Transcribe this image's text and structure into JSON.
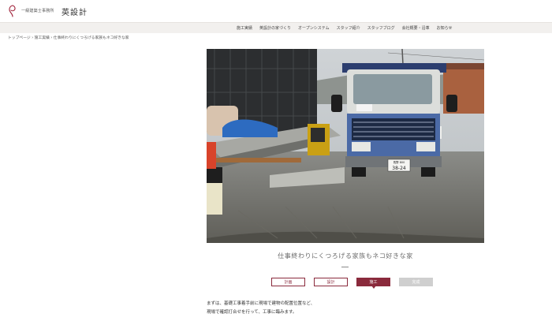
{
  "brand": {
    "sub": "一級建築士事務所",
    "name": "英設計"
  },
  "nav": {
    "items": [
      "施工実績",
      "英設計の家づくり",
      "オープンシステム",
      "スタッフ紹介",
      "スタッフブログ",
      "会社概要・沿革",
      "お知らせ"
    ]
  },
  "breadcrumb": "トップページ › 施工実績 › 仕事終わりにくつろげる家族もネコ好きな家",
  "photo": {
    "plate_top": "長野 800",
    "plate_num": "38-24"
  },
  "post": {
    "title": "仕事終わりにくつろげる家族もネコ好きな家",
    "steps": [
      "計画",
      "設計",
      "施工",
      "完成"
    ],
    "active_step": "施工",
    "body": [
      "まずは、基礎工事着手前に現場で建物の配置位置など、",
      "現場で確認打合せを行って、工事に臨みます。"
    ]
  },
  "colors": {
    "accent": "#8a2a3c",
    "nav_bg": "#f2f0ee",
    "disabled": "#cfcfcf"
  }
}
